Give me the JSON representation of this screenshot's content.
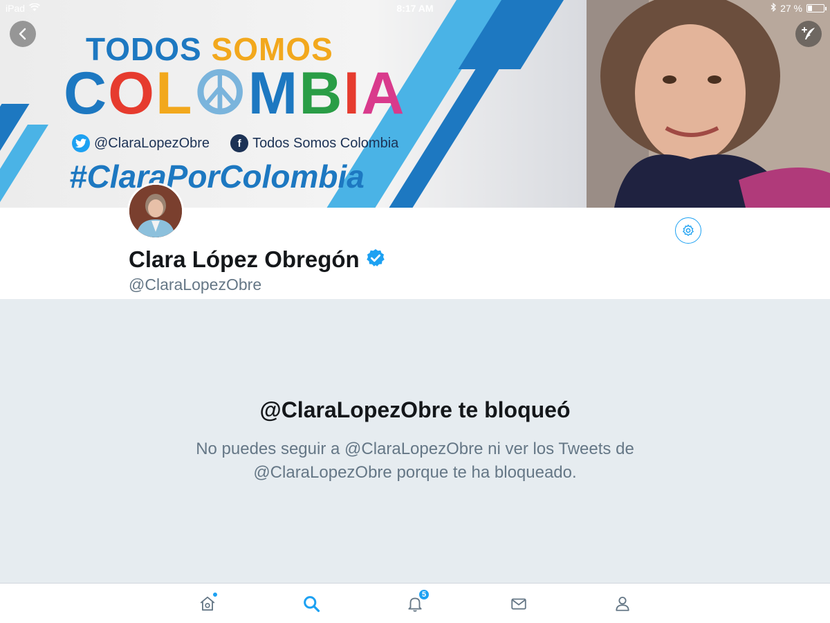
{
  "status_bar": {
    "device": "iPad",
    "time": "8:17 AM",
    "battery_text": "27 %",
    "battery_level": 0.27
  },
  "banner": {
    "title_line1_word1": "TODOS",
    "title_line1_word2": "SOMOS",
    "title_line2_letters": [
      "C",
      "O",
      "L",
      "☮",
      "M",
      "B",
      "I",
      "A"
    ],
    "title_line2_colors": [
      "#1d78c1",
      "#e63b2e",
      "#f2a81d",
      "#7ab4dc",
      "#1d78c1",
      "#2a9d46",
      "#e63b2e",
      "#d93a8c"
    ],
    "twitter_handle": "@ClaraLopezObre",
    "facebook_page": "Todos Somos Colombia",
    "hashtag": "#ClaraPorColombia"
  },
  "profile": {
    "name": "Clara López Obregón",
    "handle": "@ClaraLopezObre",
    "verified": true
  },
  "blocked": {
    "title": "@ClaraLopezObre te bloqueó",
    "message": "No puedes seguir a @ClaraLopezObre ni ver los Tweets de @ClaraLopezObre porque te ha bloqueado."
  },
  "tab_bar": {
    "items": [
      {
        "icon": "home-icon",
        "has_dot": true
      },
      {
        "icon": "search-icon",
        "active": true
      },
      {
        "icon": "notifications-icon",
        "badge": "5"
      },
      {
        "icon": "messages-icon"
      },
      {
        "icon": "profile-icon"
      }
    ]
  },
  "colors": {
    "accent": "#1da1f2",
    "text_primary": "#14171a",
    "text_secondary": "#657786",
    "background": "#e6ecf0"
  }
}
